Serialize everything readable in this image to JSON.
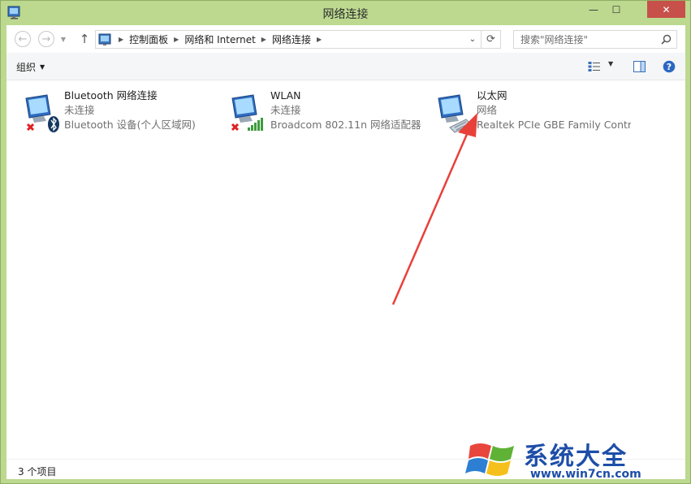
{
  "window": {
    "title": "网络连接",
    "minimize_glyph": "—",
    "maximize_glyph": "☐",
    "close_glyph": "✕"
  },
  "nav": {
    "back_glyph": "←",
    "forward_glyph": "→",
    "recent_glyph": "▼",
    "up_glyph": "↑",
    "breadcrumbs": [
      "控制面板",
      "网络和 Internet",
      "网络连接"
    ],
    "search_placeholder": "搜索\"网络连接\""
  },
  "toolbar": {
    "organize_label": "组织",
    "caret": "▼"
  },
  "connections": [
    {
      "name": "Bluetooth 网络连接",
      "status": "未连接",
      "device": "Bluetooth 设备(个人区域网)",
      "icon": "bluetooth-network-icon"
    },
    {
      "name": "WLAN",
      "status": "未连接",
      "device": "Broadcom 802.11n 网络适配器",
      "icon": "wlan-network-icon"
    },
    {
      "name": "以太网",
      "status": "网络",
      "device": "Realtek PCIe GBE Family Contr...",
      "icon": "ethernet-network-icon"
    }
  ],
  "status_bar": {
    "item_count": "3 个项目"
  },
  "watermark": {
    "title": "系统大全",
    "url": "www.win7cn.com"
  },
  "colors": {
    "frame": "#bcd98f",
    "close_button": "#c7504a",
    "arrow": "#e8413a",
    "watermark": "#1d4ea8"
  }
}
